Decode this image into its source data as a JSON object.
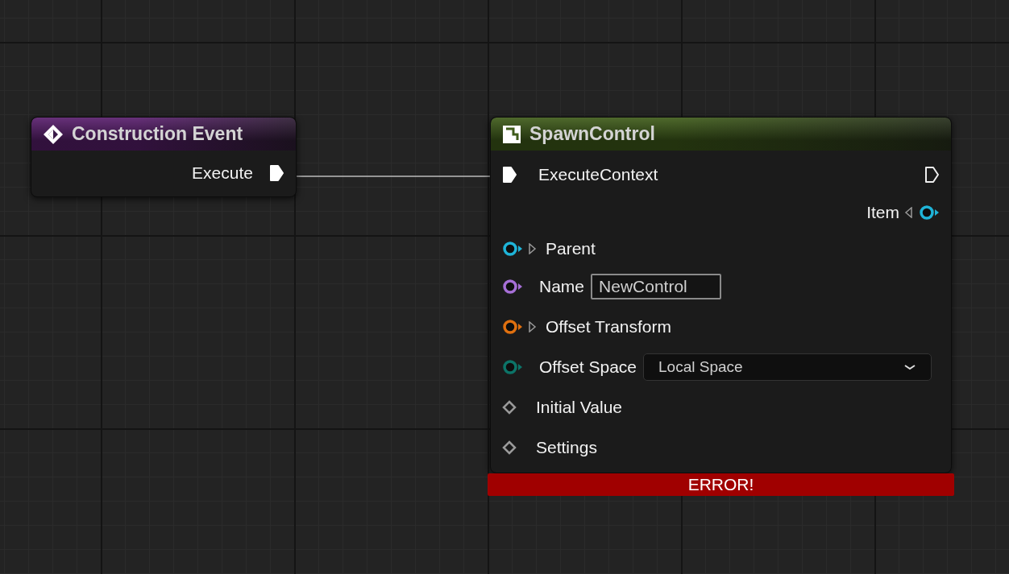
{
  "canvas": {
    "nodes": [
      {
        "kind": "event",
        "title": "Construction Event",
        "color": "#5a1f6e",
        "outputs": [
          {
            "kind": "exec",
            "label": "Execute",
            "connected": true
          }
        ]
      },
      {
        "kind": "function",
        "title": "SpawnControl",
        "color": "#3f5c1a",
        "exec_in": {
          "label": "ExecuteContext",
          "connected": true
        },
        "exec_out": {
          "connected": false
        },
        "outputs": [
          {
            "kind": "object",
            "label": "Item",
            "color": "#1fb4d8",
            "expanded": false
          }
        ],
        "inputs": [
          {
            "kind": "object",
            "label": "Parent",
            "color": "#1fb4d8",
            "expanded": false
          },
          {
            "kind": "name",
            "label": "Name",
            "color": "#a66fd6",
            "value": "NewControl"
          },
          {
            "kind": "struct",
            "label": "Offset Transform",
            "color": "#e0700f",
            "expanded": false
          },
          {
            "kind": "enum",
            "label": "Offset Space",
            "color": "#0c7468",
            "value": "Local Space"
          },
          {
            "kind": "wildcard",
            "label": "Initial Value"
          },
          {
            "kind": "wildcard",
            "label": "Settings"
          }
        ],
        "error": "ERROR!"
      }
    ]
  }
}
